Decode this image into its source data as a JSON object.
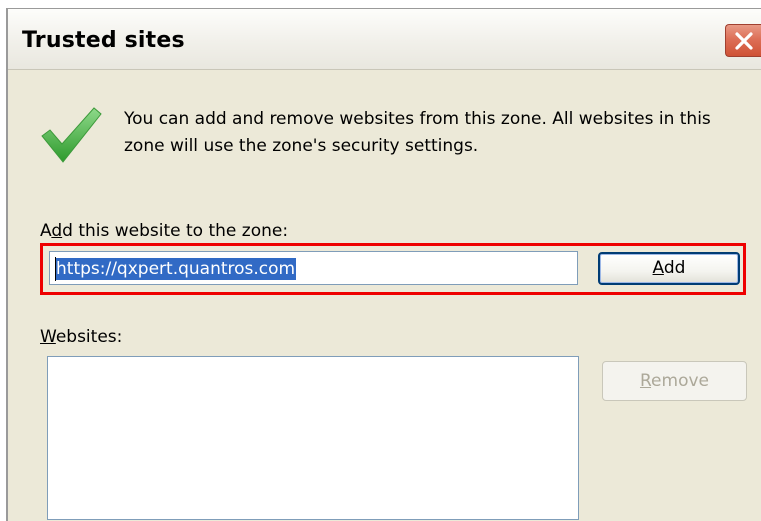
{
  "dialog": {
    "title": "Trusted sites",
    "description": "You can add and remove websites from this zone. All websites in this zone will use the zone's security settings.",
    "add_label_prefix": "A",
    "add_label_mnemonic": "d",
    "add_label_rest": "d this website to the zone:",
    "url_input_value": "https://qxpert.quantros.com",
    "add_button_mnemonic": "A",
    "add_button_rest": "dd",
    "websites_label_mnemonic": "W",
    "websites_label_rest": "ebsites:",
    "websites": [],
    "remove_button_mnemonic": "R",
    "remove_button_rest": "emove"
  },
  "icons": {
    "check": "check-icon",
    "close": "close-icon"
  },
  "colors": {
    "highlight": "#ee0000",
    "selection": "#316ac5",
    "close_button": "#dd6f57",
    "check_green": "#4cb34a",
    "dialog_background": "#ece9d8"
  }
}
